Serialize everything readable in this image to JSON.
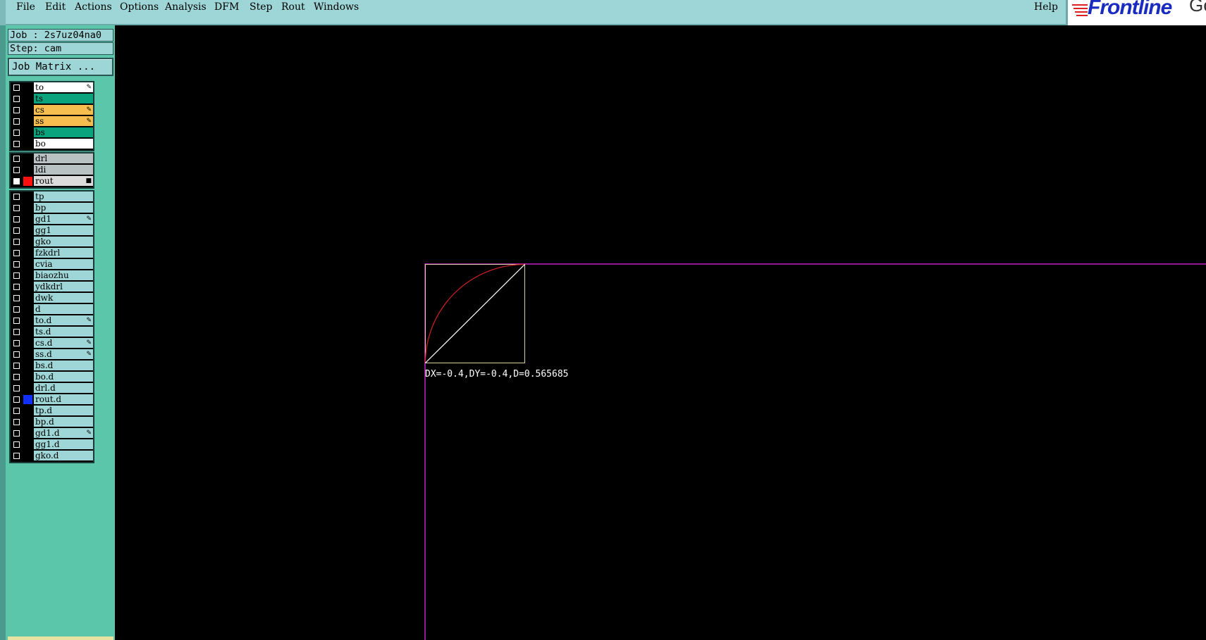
{
  "menubar": {
    "items": [
      "File",
      "Edit",
      "Actions",
      "Options",
      "Analysis",
      "DFM",
      "Step",
      "Rout",
      "Windows"
    ],
    "help": "Help",
    "logo_text": "Frontline",
    "logo_tail": "Ge"
  },
  "panel": {
    "job": "Job : 2s7uz04na0",
    "step": "Step: cam",
    "job_matrix": "Job Matrix ...",
    "groups": [
      [
        {
          "name": "to",
          "color": "#ffffff",
          "mark": true
        },
        {
          "name": "ts",
          "color": "#0aa37d",
          "mark": false
        },
        {
          "name": "cs",
          "color": "#f5be4f",
          "mark": true
        },
        {
          "name": "ss",
          "color": "#f5be4f",
          "mark": true
        },
        {
          "name": "bs",
          "color": "#0aa37d",
          "mark": false
        },
        {
          "name": "bo",
          "color": "#ffffff",
          "mark": false
        }
      ],
      [
        {
          "name": "drl",
          "color": "#b8c2c2",
          "mark": false
        },
        {
          "name": "ldi",
          "color": "#b8c2c2",
          "mark": false
        },
        {
          "name": "rout",
          "color": "#dcdcdc",
          "mark": false,
          "active": true,
          "swatch": "#ff1010",
          "square": true
        }
      ],
      [
        {
          "name": "tp",
          "color": "#9ed6d7",
          "mark": false
        },
        {
          "name": "bp",
          "color": "#9ed6d7",
          "mark": false
        },
        {
          "name": "gd1",
          "color": "#9ed6d7",
          "mark": true
        },
        {
          "name": "gg1",
          "color": "#9ed6d7",
          "mark": false
        },
        {
          "name": "gko",
          "color": "#9ed6d7",
          "mark": false
        },
        {
          "name": "fzkdrl",
          "color": "#9ed6d7",
          "mark": false
        },
        {
          "name": "cvia",
          "color": "#9ed6d7",
          "mark": false
        },
        {
          "name": "biaozhu",
          "color": "#9ed6d7",
          "mark": false
        },
        {
          "name": "ydkdrl",
          "color": "#9ed6d7",
          "mark": false
        },
        {
          "name": "dwk",
          "color": "#9ed6d7",
          "mark": false
        },
        {
          "name": "d",
          "color": "#9ed6d7",
          "mark": false
        },
        {
          "name": "to.d",
          "color": "#9ed6d7",
          "mark": true
        },
        {
          "name": "ts.d",
          "color": "#9ed6d7",
          "mark": false
        },
        {
          "name": "cs.d",
          "color": "#9ed6d7",
          "mark": true
        },
        {
          "name": "ss.d",
          "color": "#9ed6d7",
          "mark": true
        },
        {
          "name": "bs.d",
          "color": "#9ed6d7",
          "mark": false
        },
        {
          "name": "bo.d",
          "color": "#9ed6d7",
          "mark": false
        },
        {
          "name": "drl.d",
          "color": "#9ed6d7",
          "mark": false
        },
        {
          "name": "rout.d",
          "color": "#9ed6d7",
          "mark": false,
          "swatch": "#1030ff"
        },
        {
          "name": "tp.d",
          "color": "#9ed6d7",
          "mark": false
        },
        {
          "name": "bp.d",
          "color": "#9ed6d7",
          "mark": false
        },
        {
          "name": "gd1.d",
          "color": "#9ed6d7",
          "mark": true
        },
        {
          "name": "gg1.d",
          "color": "#9ed6d7",
          "mark": false
        },
        {
          "name": "gko.d",
          "color": "#9ed6d7",
          "mark": false
        }
      ]
    ]
  },
  "canvas": {
    "measure_readout": "DX=-0.4,DY=-0.4,D=0.565685",
    "profile_color": "#c020c0",
    "box_color": "#d8d0a0",
    "arc_color": "#d02020",
    "diagonal_color": "#ffffff"
  }
}
